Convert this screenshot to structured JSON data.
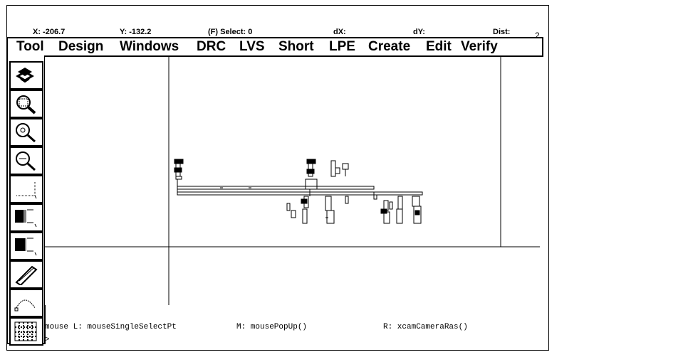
{
  "status": {
    "x": "X: -206.7",
    "y": "Y: -132.2",
    "select": "(F) Select: 0",
    "dx": "dX:",
    "dy": "dY:",
    "dist": "Dist:",
    "window_num": "2"
  },
  "menu": [
    "Tool",
    "Design",
    "Windows",
    "DRC",
    "LVS",
    "Short",
    "LPE",
    "Create",
    "Edit",
    "Verify"
  ],
  "tools": [
    {
      "name": "redraw-icon"
    },
    {
      "name": "zoom-fit-icon"
    },
    {
      "name": "zoom-in-icon"
    },
    {
      "name": "zoom-out-icon"
    },
    {
      "name": "select-area-icon"
    },
    {
      "name": "layer-stack-icon"
    },
    {
      "name": "layer-fill-icon"
    },
    {
      "name": "ruler-icon"
    },
    {
      "name": "arc-icon"
    },
    {
      "name": "grid-icon"
    }
  ],
  "command": {
    "mouse_l": "mouse L: mouseSingleSelectPt",
    "mouse_m": "M: mousePopUp()",
    "mouse_r": "R: xcamCameraRas()",
    "prompt": ">"
  }
}
